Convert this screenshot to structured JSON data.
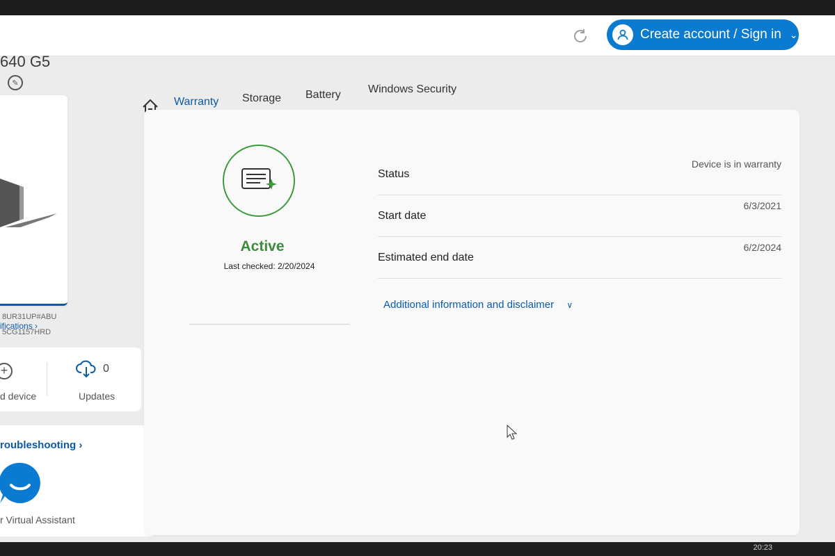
{
  "topbar": {
    "account_button_label": "Create account / Sign in"
  },
  "sidebar": {
    "device_name": "640 G5",
    "specifications_link": "ifications ›",
    "product_number": "8UR31UP#ABU",
    "serial_number": "5CG1157HRD",
    "add_device_label": "d device",
    "updates_label": "Updates",
    "updates_count": "0",
    "troubleshooting_link": "roubleshooting ›",
    "virtual_assistant_label": "r Virtual Assistant"
  },
  "tabs": [
    {
      "label": "Warranty",
      "active": true
    },
    {
      "label": "Storage",
      "active": false
    },
    {
      "label": "Battery",
      "active": false
    },
    {
      "label": "Windows Security",
      "active": false
    }
  ],
  "warranty": {
    "state": "Active",
    "last_checked": "Last checked: 2/20/2024",
    "rows": [
      {
        "label": "Status",
        "value": "Device is in warranty"
      },
      {
        "label": "Start date",
        "value": "6/3/2021"
      },
      {
        "label": "Estimated end date",
        "value": "6/2/2024"
      }
    ],
    "additional_info_link": "Additional information and disclaimer"
  },
  "taskbar": {
    "clock": "20:23"
  },
  "colors": {
    "accent_blue": "#0b7ad1",
    "link_blue": "#0b5aa8",
    "active_green": "#3d8b3d"
  }
}
